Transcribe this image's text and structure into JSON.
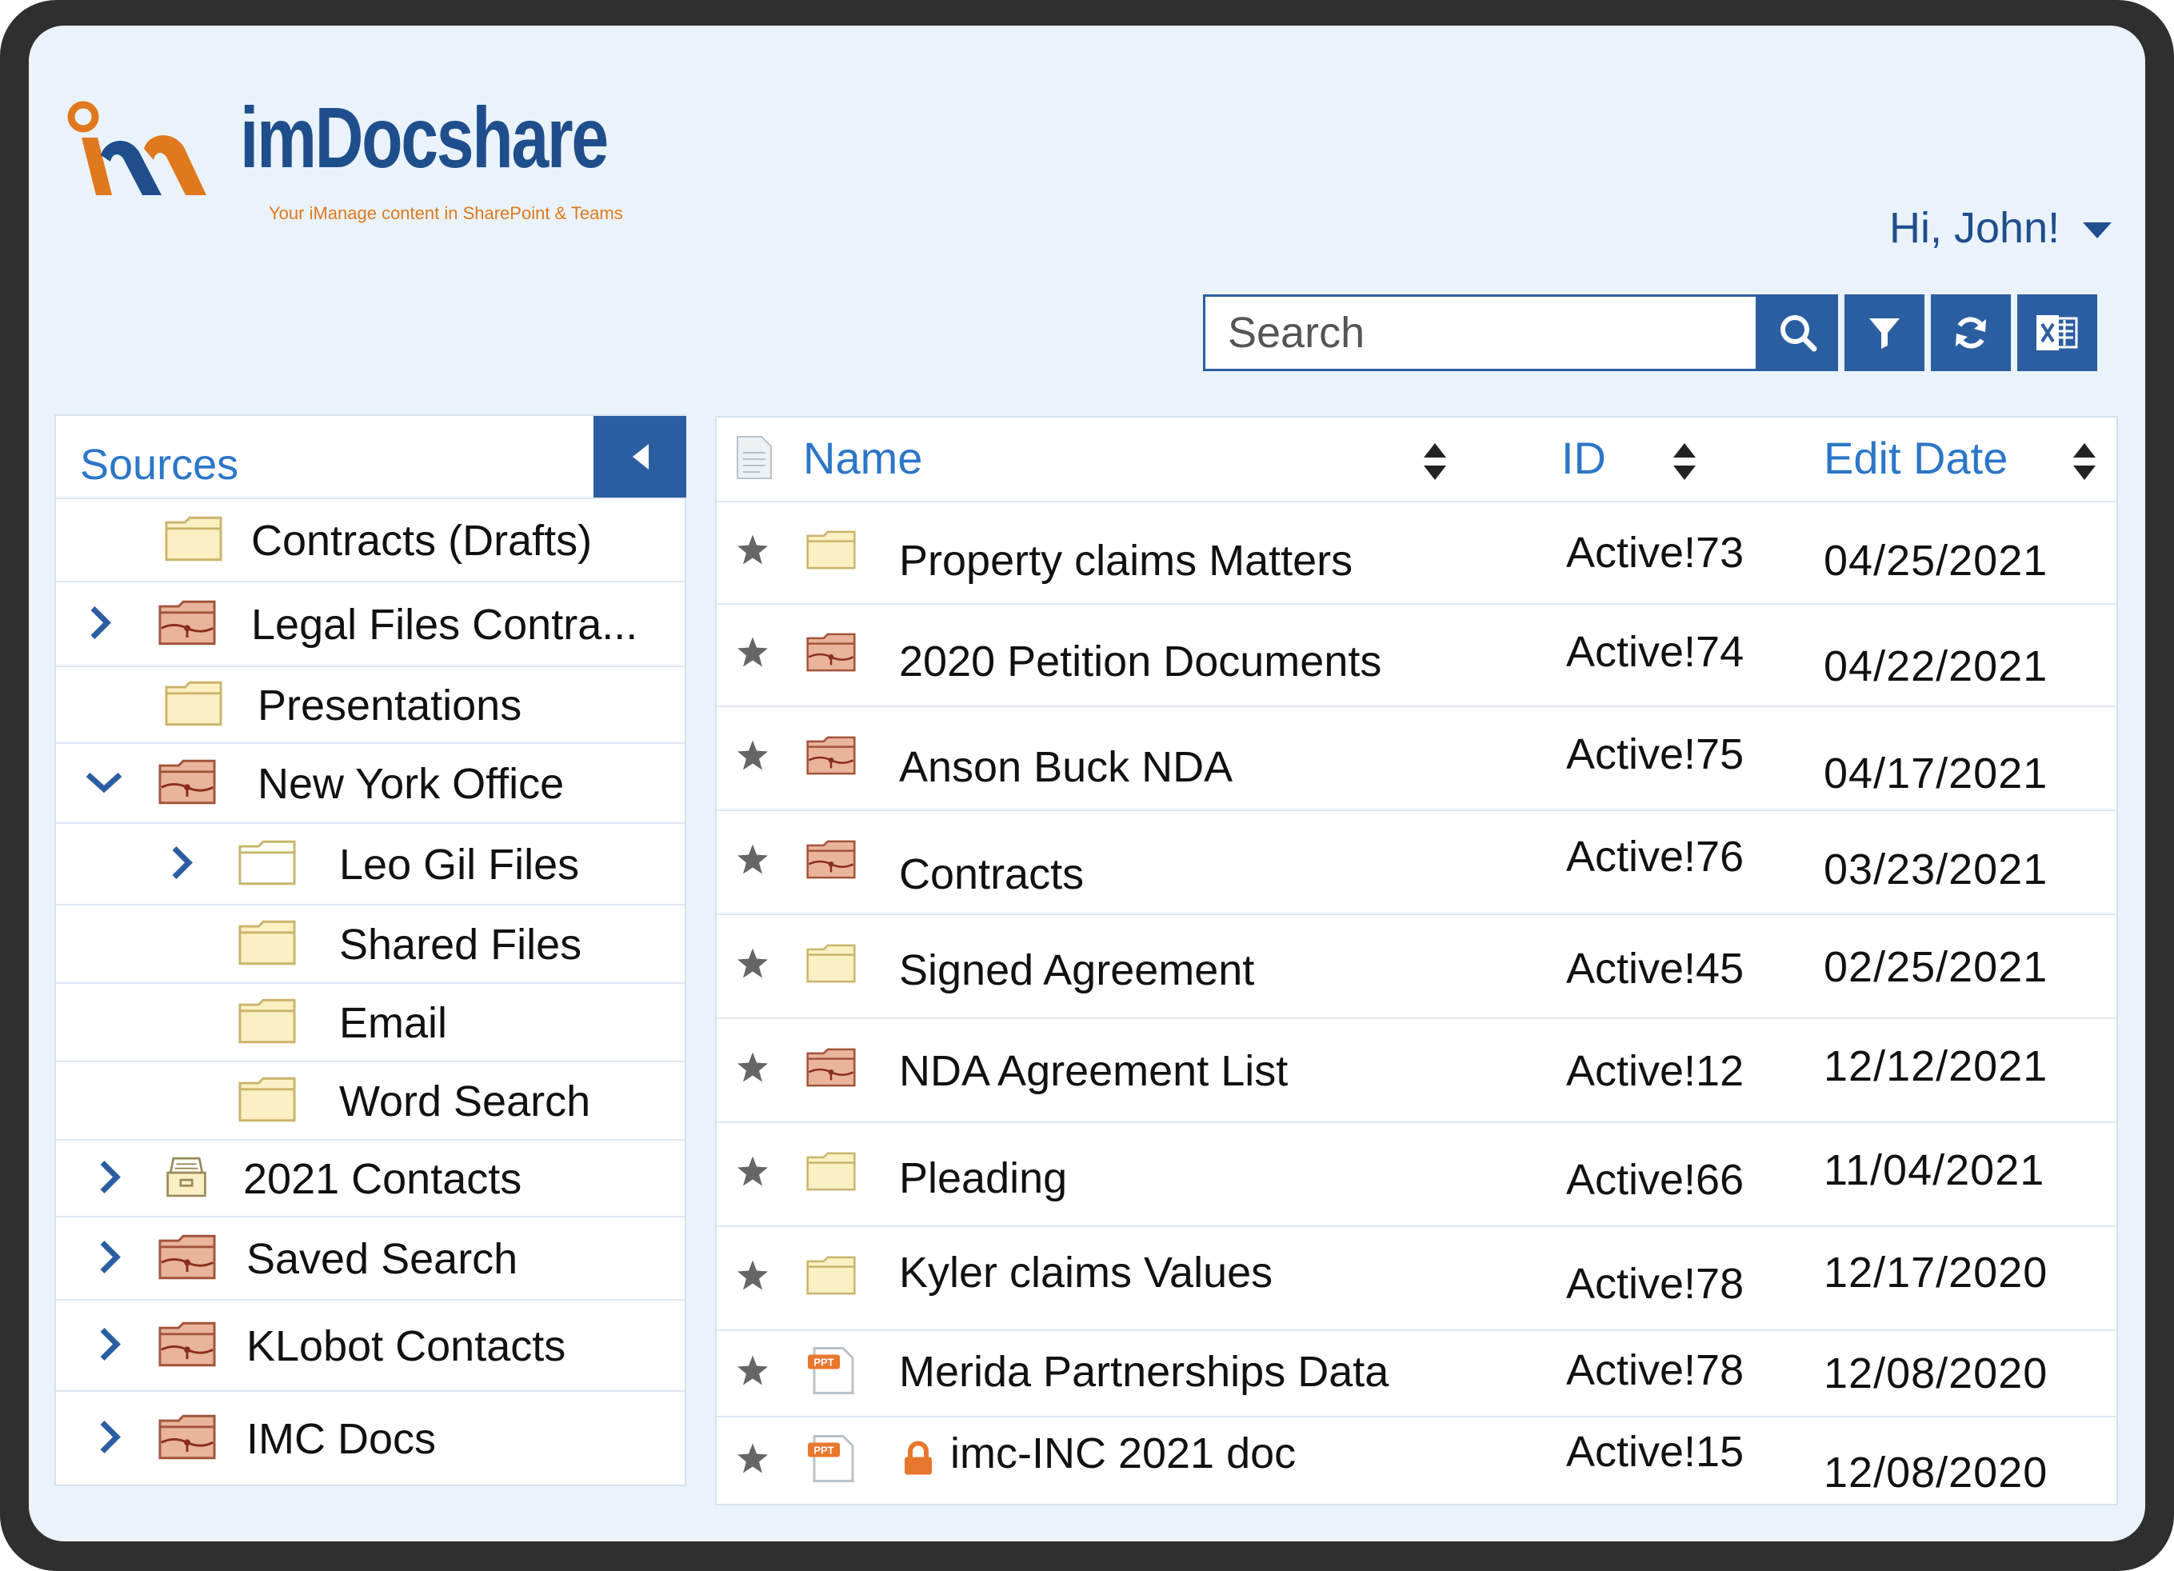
{
  "app": {
    "brand": "imDocshare",
    "tagline": "Your iManage content in SharePoint & Teams",
    "user_greeting": "Hi, John!"
  },
  "colors": {
    "primary": "#2b5ea1",
    "link": "#2b76c8",
    "brand_blue": "#1f4e8c",
    "brand_orange": "#e0781e",
    "background": "#eaf3fb"
  },
  "toolbar": {
    "search_placeholder": "Search",
    "buttons": [
      "search-icon",
      "filter-icon",
      "refresh-icon",
      "excel-export-icon"
    ]
  },
  "sources": {
    "title": "Sources",
    "items": [
      {
        "label": "Contracts (Drafts)",
        "icon": "folder-icon",
        "expandable": false
      },
      {
        "label": "Legal Files Contra...",
        "icon": "matter-folder-icon",
        "expandable": true,
        "expanded": false
      },
      {
        "label": "Presentations",
        "icon": "folder-icon",
        "expandable": false
      },
      {
        "label": "New York Office",
        "icon": "matter-folder-icon",
        "expandable": true,
        "expanded": true
      },
      {
        "label": "Leo Gil Files",
        "icon": "folder-outline-icon",
        "expandable": true,
        "expanded": false
      },
      {
        "label": "Shared Files",
        "icon": "folder-icon",
        "expandable": false
      },
      {
        "label": "Email",
        "icon": "folder-icon",
        "expandable": false
      },
      {
        "label": "Word Search",
        "icon": "folder-icon",
        "expandable": false
      },
      {
        "label": "2021 Contacts",
        "icon": "archive-box-icon",
        "expandable": true,
        "expanded": false
      },
      {
        "label": "Saved Search",
        "icon": "matter-folder-icon",
        "expandable": true,
        "expanded": false
      },
      {
        "label": "KLobot Contacts",
        "icon": "matter-folder-icon",
        "expandable": true,
        "expanded": false
      },
      {
        "label": "IMC Docs",
        "icon": "matter-folder-icon",
        "expandable": true,
        "expanded": false
      }
    ]
  },
  "documents": {
    "columns": {
      "name": "Name",
      "id": "ID",
      "date": "Edit Date"
    },
    "rows": [
      {
        "name": "Property claims Matters",
        "id": "Active!73",
        "date": "04/25/2021",
        "icon": "folder-icon"
      },
      {
        "name": "2020 Petition Documents",
        "id": "Active!74",
        "date": "04/22/2021",
        "icon": "matter-folder-icon"
      },
      {
        "name": "Anson Buck NDA",
        "id": "Active!75",
        "date": "04/17/2021",
        "icon": "matter-folder-icon"
      },
      {
        "name": "Contracts",
        "id": "Active!76",
        "date": "03/23/2021",
        "icon": "matter-folder-icon"
      },
      {
        "name": "Signed Agreement",
        "id": "Active!45",
        "date": "02/25/2021",
        "icon": "folder-icon"
      },
      {
        "name": "NDA Agreement List",
        "id": "Active!12",
        "date": "12/12/2021",
        "icon": "matter-folder-icon"
      },
      {
        "name": "Pleading",
        "id": "Active!66",
        "date": "11/04/2021",
        "icon": "folder-icon"
      },
      {
        "name": "Kyler claims Values",
        "id": "Active!78",
        "date": "12/17/2020",
        "icon": "folder-icon"
      },
      {
        "name": "Merida Partnerships Data",
        "id": "Active!78",
        "date": "12/08/2020",
        "icon": "ppt-file-icon",
        "badge": "PPT"
      },
      {
        "name": "imc-INC 2021 doc",
        "id": "Active!15",
        "date": "12/08/2020",
        "icon": "ppt-file-icon",
        "badge": "PPT",
        "locked": true
      }
    ]
  }
}
